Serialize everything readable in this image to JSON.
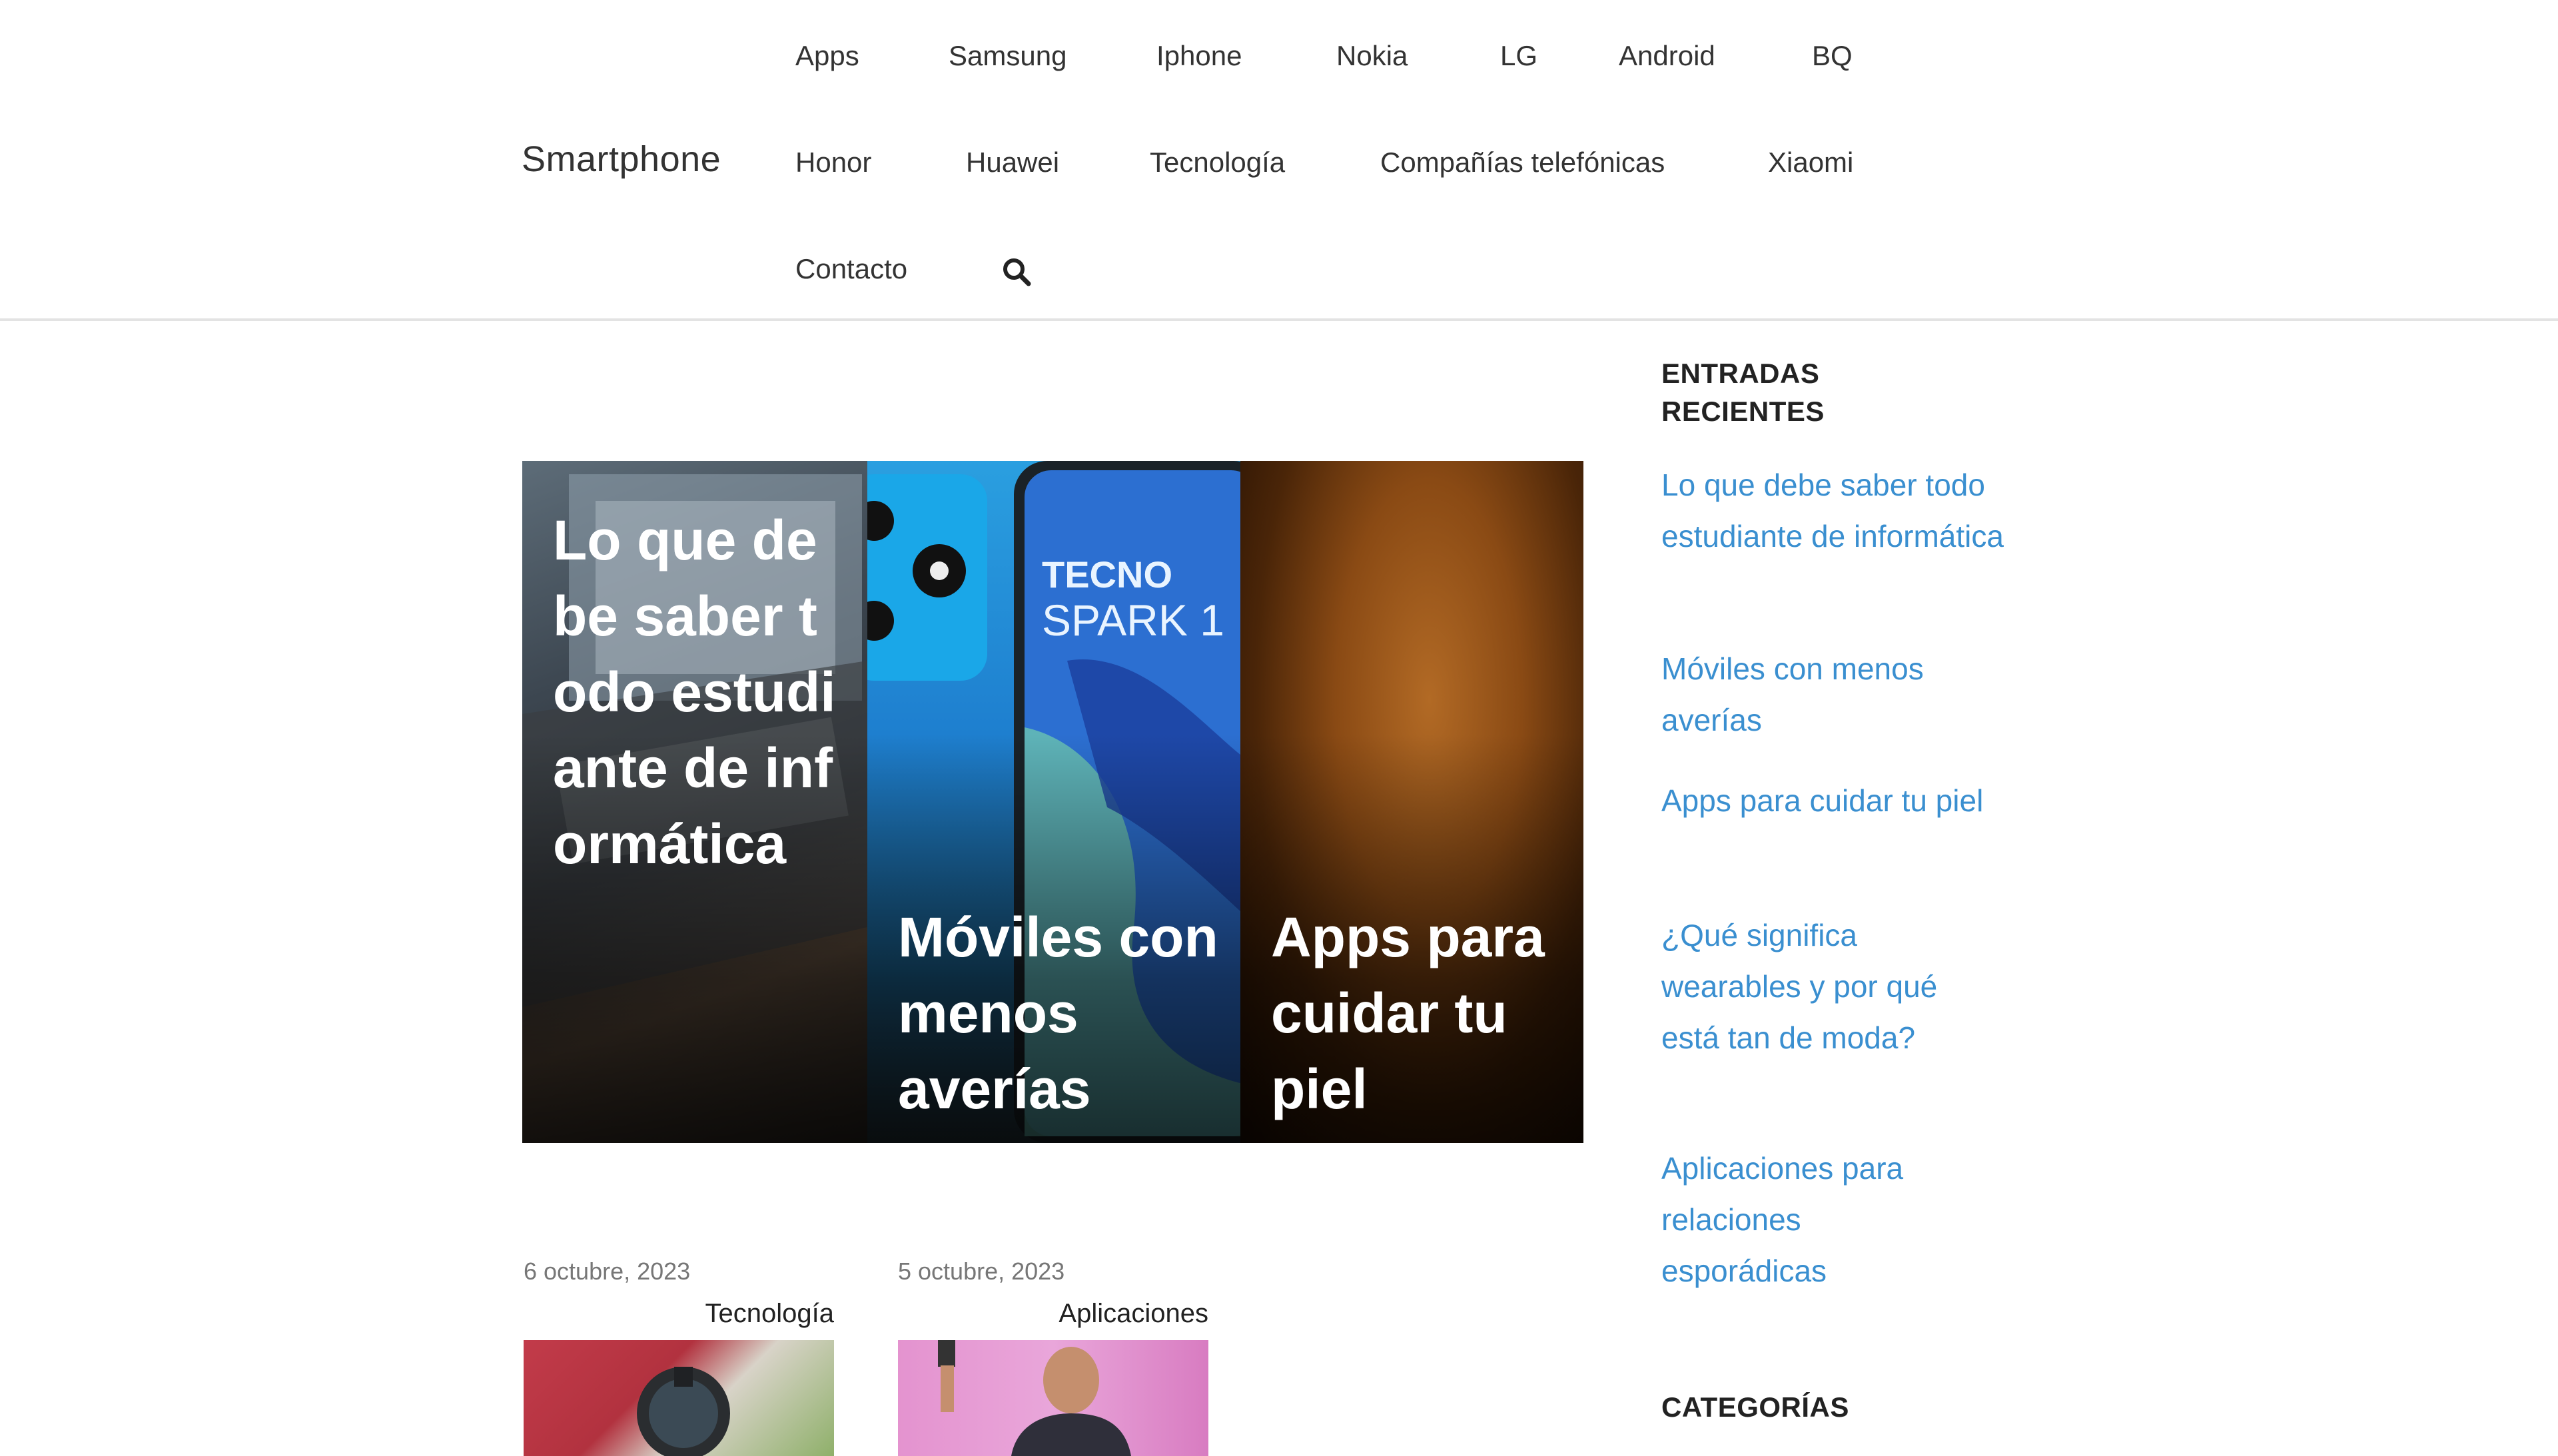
{
  "header": {
    "brand": "Smartphone",
    "nav": [
      "Apps",
      "Samsung",
      "Iphone",
      "Nokia",
      "LG",
      "Android",
      "BQ",
      "Honor",
      "Huawei",
      "Tecnología",
      "Compañías telefónicas",
      "Xiaomi",
      "Contacto"
    ],
    "search_icon": "search-icon"
  },
  "featured": [
    {
      "title": "Lo que debe saber todo estudiante de informática"
    },
    {
      "title": "Móviles con menos averías",
      "image_text_1": "TECNO",
      "image_text_2": "SPARK 1"
    },
    {
      "title": "Apps para cuidar tu piel"
    }
  ],
  "posts": [
    {
      "date": "6 octubre, 2023",
      "category": "Tecnología"
    },
    {
      "date": "5 octubre, 2023",
      "category": "Aplicaciones"
    }
  ],
  "sidebar": {
    "recent_title": "ENTRADAS RECIENTES",
    "recent": [
      "Lo que debe saber todo estudiante de informática",
      "Móviles con menos averías",
      "Apps para cuidar tu piel",
      "¿Qué significa wearables y por qué está tan de moda?",
      "Aplicaciones para relaciones esporádicas"
    ],
    "categories_title": "CATEGORÍAS"
  },
  "colors": {
    "link": "#3a8fd0",
    "text": "#222222",
    "border": "#e3e3e3"
  }
}
